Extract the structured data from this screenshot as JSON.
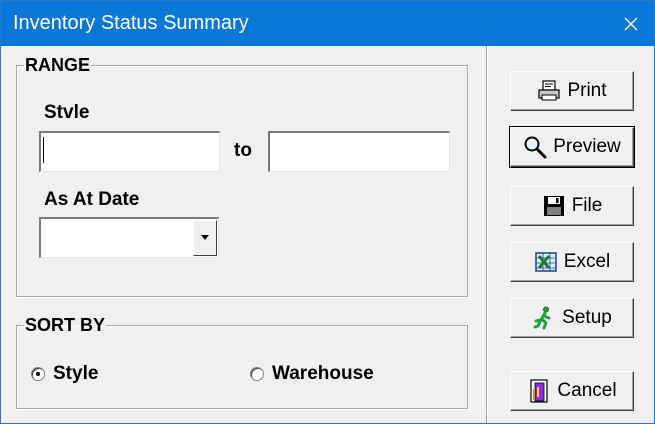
{
  "window": {
    "title": "Inventory Status Summary"
  },
  "range": {
    "legend": "RANGE",
    "style_label": "Stvle",
    "style_from_value": "",
    "to_label": "to",
    "style_to_value": "",
    "as_at_date_label": "As At Date",
    "as_at_date_value": ""
  },
  "sort_by": {
    "legend": "SORT BY",
    "options": [
      {
        "label": "Style",
        "selected": true
      },
      {
        "label": "Warehouse",
        "selected": false
      }
    ]
  },
  "buttons": {
    "print": "Print",
    "preview": "Preview",
    "file": "File",
    "excel": "Excel",
    "setup": "Setup",
    "cancel": "Cancel"
  },
  "icons": {
    "close": "close-icon",
    "print": "printer-icon",
    "preview": "magnifier-icon",
    "file": "floppy-disk-icon",
    "excel": "excel-icon",
    "setup": "running-man-icon",
    "cancel": "exit-door-icon",
    "dropdown": "chevron-down-icon"
  },
  "colors": {
    "titlebar": "#0b78d7",
    "dialog_bg": "#f0f0f0",
    "excel_green": "#1e7a2a",
    "setup_green": "#22a33a",
    "exit_purple": "#8a2be2"
  }
}
